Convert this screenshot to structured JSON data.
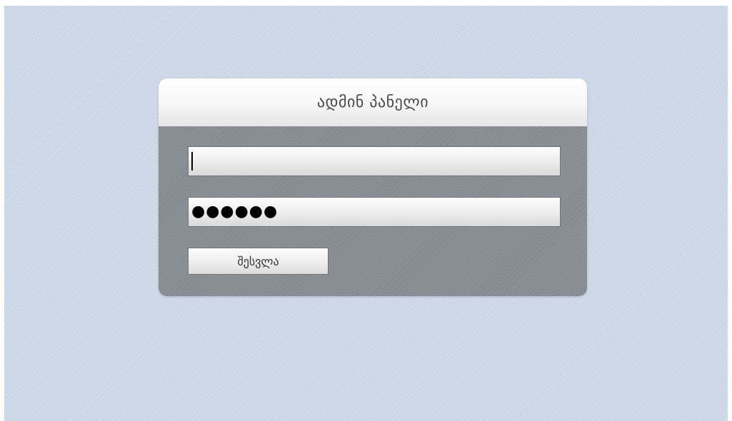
{
  "login_panel": {
    "title": "ადმინ პანელი",
    "username": {
      "value": ""
    },
    "password": {
      "masked_value": "●●●●●●"
    },
    "submit_label": "შესვლა"
  }
}
